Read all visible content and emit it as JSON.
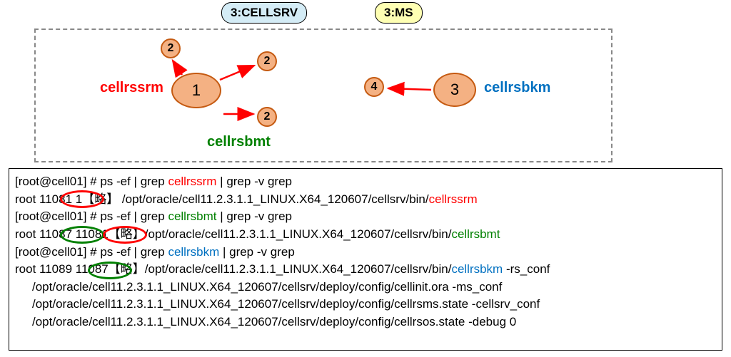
{
  "tags": {
    "cellsrv": "3:CELLSRV",
    "ms": "3:MS"
  },
  "ovals": {
    "one": "1",
    "three": "3"
  },
  "circles": {
    "two_a": "2",
    "two_b": "2",
    "two_c": "2",
    "four": "4"
  },
  "labels": {
    "cellrssrm": "cellrssrm",
    "cellrsbmt": "cellrsbmt",
    "cellrsbkm": "cellrsbkm"
  },
  "terminal": {
    "l1_prefix": "[root@cell01] # ps -ef | grep ",
    "l1_proc": "cellrssrm",
    "l1_suffix": " | grep -v grep",
    "l2_a": "root     11081       1【略】  /opt/oracle/cell11.2.3.1.1_LINUX.X64_120607/cellsrv/bin/",
    "l2_b": "cellrssrm",
    "l3_prefix": "[root@cell01] # ps -ef | grep ",
    "l3_proc": "cellrsbmt",
    "l3_suffix": " | grep -v grep",
    "l4_a": "root     11087 11081【略】/opt/oracle/cell11.2.3.1.1_LINUX.X64_120607/cellsrv/bin/",
    "l4_b": "cellrsbmt",
    "l5_prefix": "[root@cell01] # ps -ef | grep ",
    "l5_proc": "cellrsbkm",
    "l5_suffix": " | grep -v grep",
    "l6_a": "root      11089 11087【略】/opt/oracle/cell11.2.3.1.1_LINUX.X64_120607/cellsrv/bin/",
    "l6_b": "cellrsbkm",
    "l6_c": " -rs_conf",
    "l7": "/opt/oracle/cell11.2.3.1.1_LINUX.X64_120607/cellsrv/deploy/config/cellinit.ora -ms_conf",
    "l8": "/opt/oracle/cell11.2.3.1.1_LINUX.X64_120607/cellsrv/deploy/config/cellrsms.state -cellsrv_conf",
    "l9": "/opt/oracle/cell11.2.3.1.1_LINUX.X64_120607/cellsrv/deploy/config/cellrsos.state -debug 0"
  },
  "chart_data": {
    "type": "diagram",
    "title": "Cell server process hierarchy",
    "tags": [
      "3:CELLSRV",
      "3:MS"
    ],
    "nodes": [
      {
        "id": "1",
        "label": "cellrssrm",
        "color": "red"
      },
      {
        "id": "2a",
        "label": "2"
      },
      {
        "id": "2b",
        "label": "2"
      },
      {
        "id": "2c",
        "label": "2 (cellrsbmt)",
        "color": "green"
      },
      {
        "id": "3",
        "label": "cellrsbkm",
        "color": "blue"
      },
      {
        "id": "4",
        "label": "4"
      }
    ],
    "edges": [
      {
        "from": "1",
        "to": "2a"
      },
      {
        "from": "1",
        "to": "2b"
      },
      {
        "from": "1",
        "to": "2c"
      },
      {
        "from": "3",
        "to": "4"
      }
    ],
    "process_table": [
      {
        "pid": 11081,
        "ppid": 1,
        "cmd": "cellrssrm"
      },
      {
        "pid": 11087,
        "ppid": 11081,
        "cmd": "cellrsbmt"
      },
      {
        "pid": 11089,
        "ppid": 11087,
        "cmd": "cellrsbkm"
      }
    ]
  }
}
